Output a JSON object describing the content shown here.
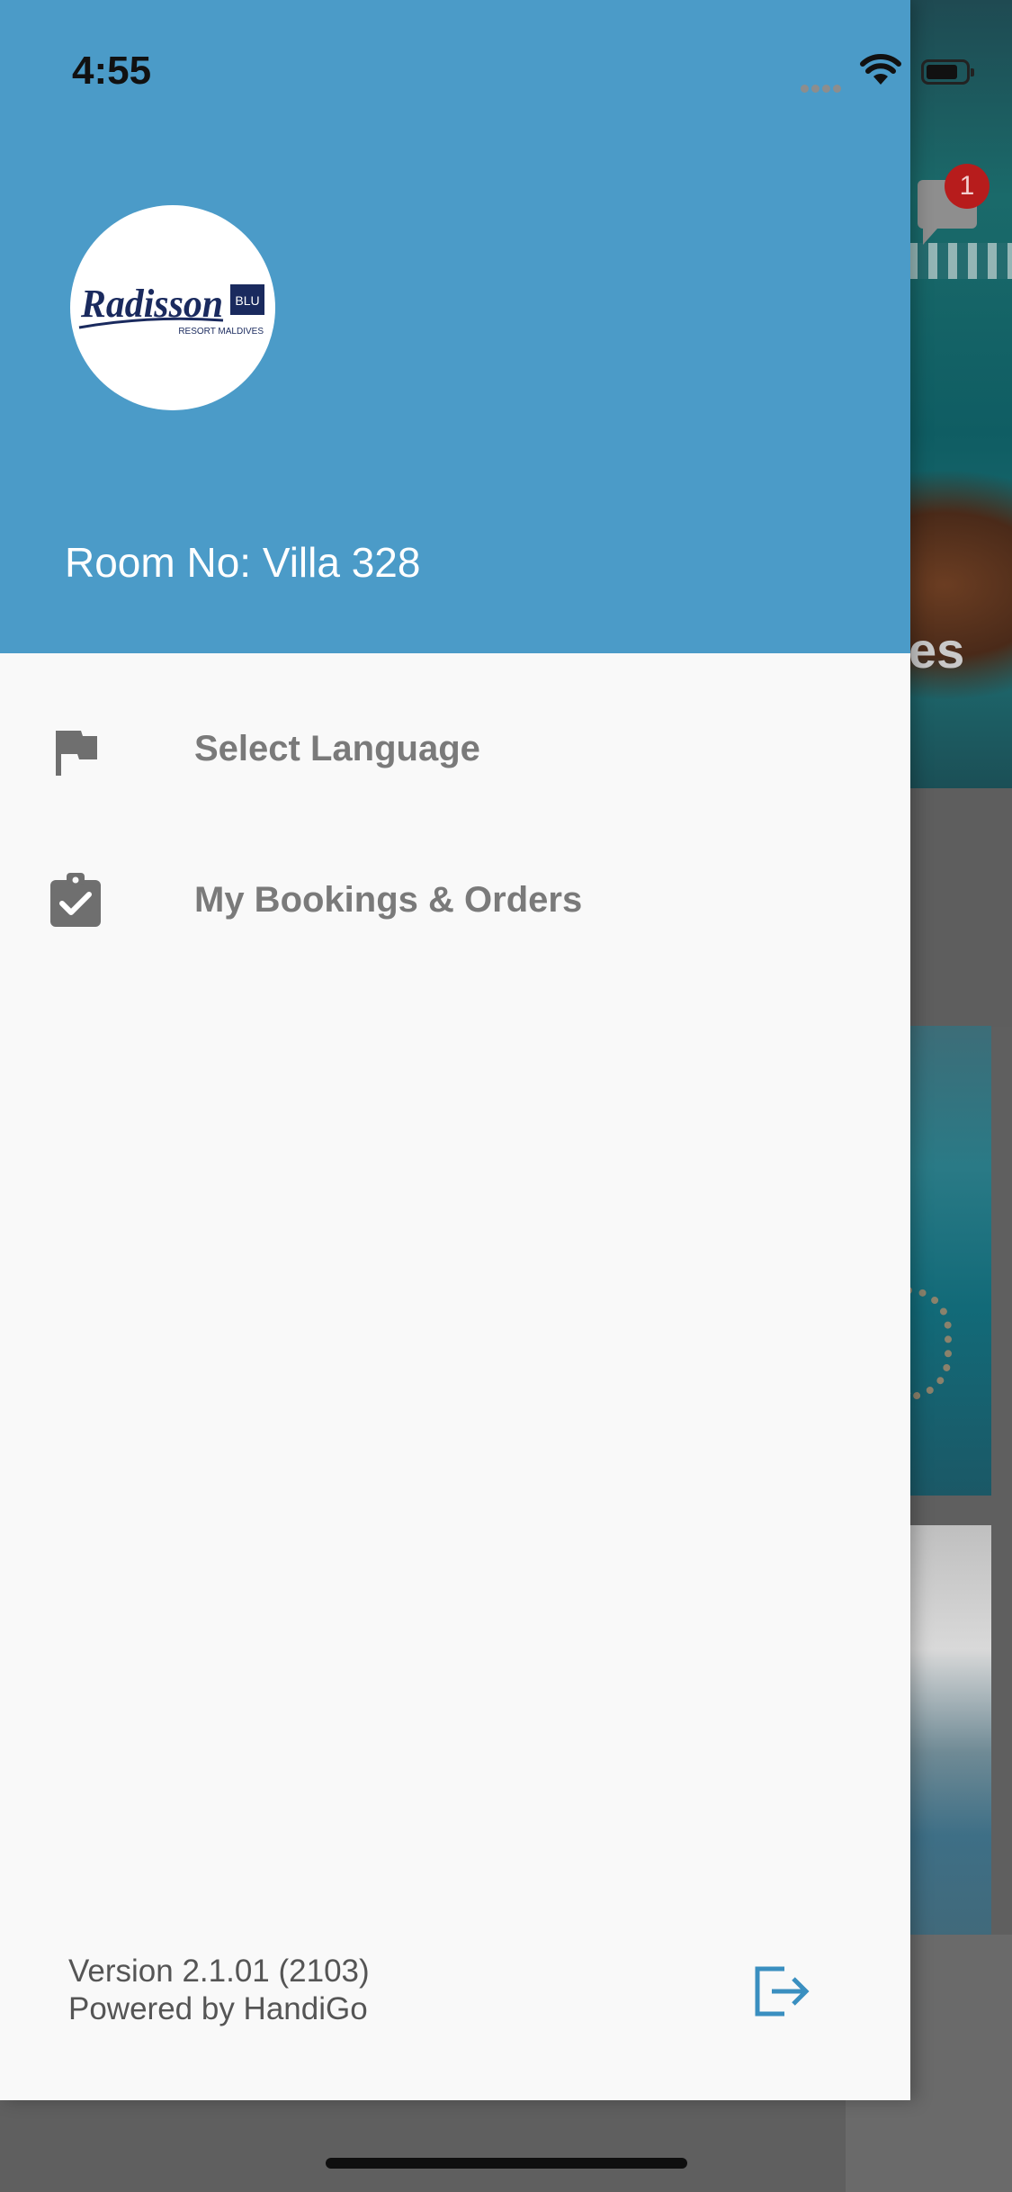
{
  "status_bar": {
    "time": "4:55",
    "icons": [
      "signal-dots-icon",
      "wifi-icon",
      "battery-icon"
    ]
  },
  "drawer": {
    "header": {
      "logo": {
        "brand": "Radisson",
        "badge": "BLU",
        "tagline": "RESORT MALDIVES"
      },
      "room_label": "Room No: Villa 328",
      "background_color": "#4b9bc8"
    },
    "menu": [
      {
        "label": "Select Language",
        "icon": "flag-icon"
      },
      {
        "label": "My Bookings & Orders",
        "icon": "clipboard-check-icon"
      }
    ],
    "footer": {
      "version": "Version 2.1.01 (2103)",
      "powered_by": "Powered by HandiGo",
      "logout_icon": "logout-icon",
      "logout_color": "#3a8fc0"
    }
  },
  "background_app": {
    "notification_count": "1",
    "partial_title": "es"
  }
}
